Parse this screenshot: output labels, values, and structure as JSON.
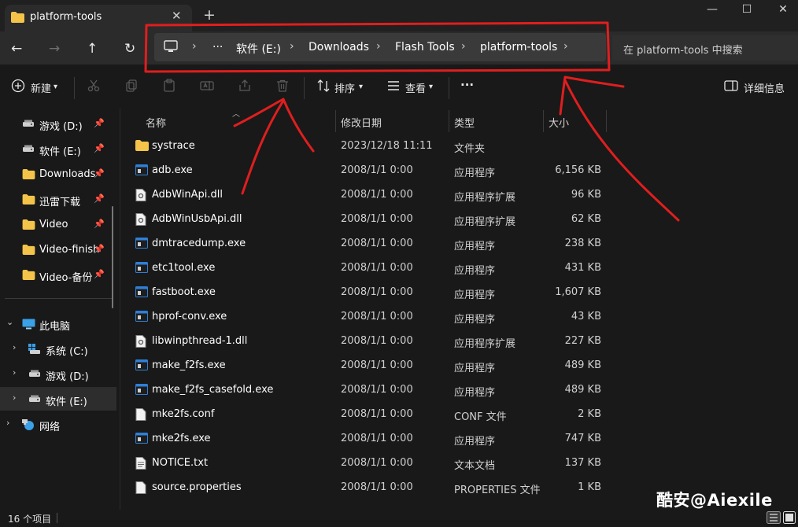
{
  "tab": {
    "title": "platform-tools",
    "close": "✕",
    "new_tab": "+"
  },
  "window_controls": {
    "minimize": "—",
    "maximize": "☐",
    "close": "✕"
  },
  "nav": {
    "back": "←",
    "forward": "→",
    "up": "↑",
    "refresh": "↻"
  },
  "breadcrumb": {
    "ellipsis": "···",
    "items": [
      "软件 (E:)",
      "Downloads",
      "Flash Tools",
      "platform-tools"
    ],
    "chevron": "›"
  },
  "search": {
    "placeholder": "在 platform-tools 中搜索"
  },
  "toolbar": {
    "new_label": "新建",
    "sort_label": "排序",
    "view_label": "查看",
    "more_label": "···",
    "details_label": "详细信息"
  },
  "sidebar": {
    "quick": [
      {
        "label": "游戏 (D:)",
        "icon": "drive-icon"
      },
      {
        "label": "软件 (E:)",
        "icon": "drive-icon"
      },
      {
        "label": "Downloads",
        "icon": "folder-icon"
      },
      {
        "label": "迅雷下载",
        "icon": "folder-icon"
      },
      {
        "label": "Video",
        "icon": "folder-icon"
      },
      {
        "label": "Video-finish",
        "icon": "folder-icon"
      },
      {
        "label": "Video-备份",
        "icon": "folder-icon"
      }
    ],
    "this_pc": "此电脑",
    "drives": [
      {
        "label": "系统 (C:)",
        "icon": "windows-drive-icon"
      },
      {
        "label": "游戏 (D:)",
        "icon": "drive-icon"
      },
      {
        "label": "软件 (E:)",
        "icon": "drive-icon"
      }
    ],
    "network": "网络"
  },
  "columns": {
    "name": "名称",
    "date": "修改日期",
    "type": "类型",
    "size": "大小"
  },
  "files": [
    {
      "name": "systrace",
      "date": "2023/12/18 11:11",
      "type": "文件夹",
      "size": "",
      "icon": "folder-icon"
    },
    {
      "name": "adb.exe",
      "date": "2008/1/1 0:00",
      "type": "应用程序",
      "size": "6,156 KB",
      "icon": "exe-icon"
    },
    {
      "name": "AdbWinApi.dll",
      "date": "2008/1/1 0:00",
      "type": "应用程序扩展",
      "size": "96 KB",
      "icon": "dll-icon"
    },
    {
      "name": "AdbWinUsbApi.dll",
      "date": "2008/1/1 0:00",
      "type": "应用程序扩展",
      "size": "62 KB",
      "icon": "dll-icon"
    },
    {
      "name": "dmtracedump.exe",
      "date": "2008/1/1 0:00",
      "type": "应用程序",
      "size": "238 KB",
      "icon": "exe-icon"
    },
    {
      "name": "etc1tool.exe",
      "date": "2008/1/1 0:00",
      "type": "应用程序",
      "size": "431 KB",
      "icon": "exe-icon"
    },
    {
      "name": "fastboot.exe",
      "date": "2008/1/1 0:00",
      "type": "应用程序",
      "size": "1,607 KB",
      "icon": "exe-icon"
    },
    {
      "name": "hprof-conv.exe",
      "date": "2008/1/1 0:00",
      "type": "应用程序",
      "size": "43 KB",
      "icon": "exe-icon"
    },
    {
      "name": "libwinpthread-1.dll",
      "date": "2008/1/1 0:00",
      "type": "应用程序扩展",
      "size": "227 KB",
      "icon": "dll-icon"
    },
    {
      "name": "make_f2fs.exe",
      "date": "2008/1/1 0:00",
      "type": "应用程序",
      "size": "489 KB",
      "icon": "exe-icon"
    },
    {
      "name": "make_f2fs_casefold.exe",
      "date": "2008/1/1 0:00",
      "type": "应用程序",
      "size": "489 KB",
      "icon": "exe-icon"
    },
    {
      "name": "mke2fs.conf",
      "date": "2008/1/1 0:00",
      "type": "CONF 文件",
      "size": "2 KB",
      "icon": "file-icon"
    },
    {
      "name": "mke2fs.exe",
      "date": "2008/1/1 0:00",
      "type": "应用程序",
      "size": "747 KB",
      "icon": "exe-icon"
    },
    {
      "name": "NOTICE.txt",
      "date": "2008/1/1 0:00",
      "type": "文本文档",
      "size": "137 KB",
      "icon": "text-file-icon"
    },
    {
      "name": "source.properties",
      "date": "2008/1/1 0:00",
      "type": "PROPERTIES 文件",
      "size": "1 KB",
      "icon": "file-icon"
    }
  ],
  "status": {
    "item_count": "16 个项目"
  },
  "watermark": "酷安@Aiexile",
  "colors": {
    "background": "#191919",
    "folder": "#f4c349",
    "annotation_red": "#e01e1e",
    "exe_blue": "#2f7fd6"
  }
}
